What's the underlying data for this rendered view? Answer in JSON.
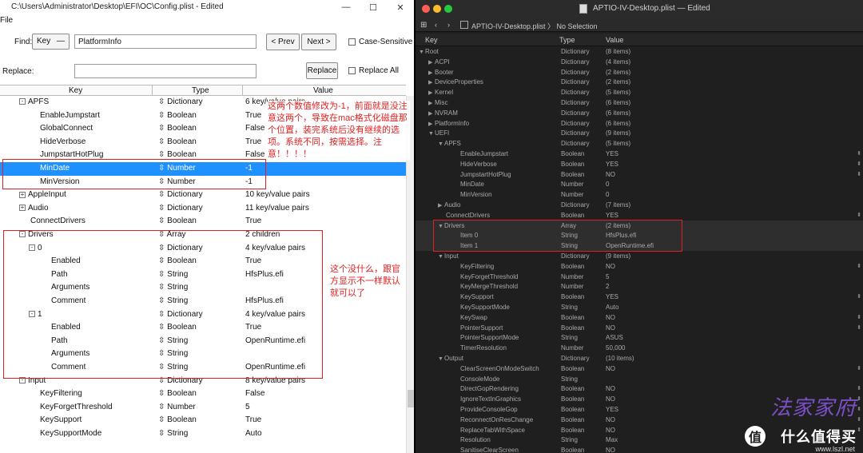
{
  "left": {
    "title": "C:\\Users\\Administrator\\Desktop\\EFI\\OC\\Config.plist - Edited",
    "win_minimize": "—",
    "win_maximize": "☐",
    "win_close": "✕",
    "menu_file": "File",
    "find_label": "Find:",
    "find_type": "Key",
    "find_value": "PlatformInfo",
    "prev_label": "< Prev",
    "next_label": "Next >",
    "case_label": "Case-Sensitive",
    "replace_label": "Replace:",
    "replace_value": "",
    "replace_btn": "Replace",
    "replace_all_label": "Replace All",
    "columns": {
      "key": "Key",
      "type": "Type",
      "value": "Value"
    },
    "rows": [
      {
        "k": "APFS",
        "t": "Dictionary",
        "v": "6 key/value pairs",
        "exp": "-",
        "indent": 1
      },
      {
        "k": "EnableJumpstart",
        "t": "Boolean",
        "v": "True",
        "exp": "",
        "indent": 2
      },
      {
        "k": "GlobalConnect",
        "t": "Boolean",
        "v": "False",
        "exp": "",
        "indent": 2
      },
      {
        "k": "HideVerbose",
        "t": "Boolean",
        "v": "True",
        "exp": "",
        "indent": 2
      },
      {
        "k": "JumpstartHotPlug",
        "t": "Boolean",
        "v": "False",
        "exp": "",
        "indent": 2
      },
      {
        "k": "MinDate",
        "t": "Number",
        "v": "-1",
        "exp": "",
        "indent": 2,
        "sel": true
      },
      {
        "k": "MinVersion",
        "t": "Number",
        "v": "-1",
        "exp": "",
        "indent": 2
      },
      {
        "k": "AppleInput",
        "t": "Dictionary",
        "v": "10 key/value pairs",
        "exp": "+",
        "indent": 1
      },
      {
        "k": "Audio",
        "t": "Dictionary",
        "v": "11 key/value pairs",
        "exp": "+",
        "indent": 1
      },
      {
        "k": "ConnectDrivers",
        "t": "Boolean",
        "v": "True",
        "exp": "",
        "indent": 1
      },
      {
        "k": "Drivers",
        "t": "Array",
        "v": "2 children",
        "exp": "-",
        "indent": 1
      },
      {
        "k": "0",
        "t": "Dictionary",
        "v": "4 key/value pairs",
        "exp": "-",
        "indent": 2
      },
      {
        "k": "Enabled",
        "t": "Boolean",
        "v": "True",
        "exp": "",
        "indent": 3
      },
      {
        "k": "Path",
        "t": "String",
        "v": "HfsPlus.efi",
        "exp": "",
        "indent": 3
      },
      {
        "k": "Arguments",
        "t": "String",
        "v": "",
        "exp": "",
        "indent": 3
      },
      {
        "k": "Comment",
        "t": "String",
        "v": "HfsPlus.efi",
        "exp": "",
        "indent": 3
      },
      {
        "k": "1",
        "t": "Dictionary",
        "v": "4 key/value pairs",
        "exp": "-",
        "indent": 2
      },
      {
        "k": "Enabled",
        "t": "Boolean",
        "v": "True",
        "exp": "",
        "indent": 3
      },
      {
        "k": "Path",
        "t": "String",
        "v": "OpenRuntime.efi",
        "exp": "",
        "indent": 3
      },
      {
        "k": "Arguments",
        "t": "String",
        "v": "",
        "exp": "",
        "indent": 3
      },
      {
        "k": "Comment",
        "t": "String",
        "v": "OpenRuntime.efi",
        "exp": "",
        "indent": 3
      },
      {
        "k": "Input",
        "t": "Dictionary",
        "v": "8 key/value pairs",
        "exp": "-",
        "indent": 1
      },
      {
        "k": "KeyFiltering",
        "t": "Boolean",
        "v": "False",
        "exp": "",
        "indent": 2
      },
      {
        "k": "KeyForgetThreshold",
        "t": "Number",
        "v": "5",
        "exp": "",
        "indent": 2
      },
      {
        "k": "KeySupport",
        "t": "Boolean",
        "v": "True",
        "exp": "",
        "indent": 2
      },
      {
        "k": "KeySupportMode",
        "t": "String",
        "v": "Auto",
        "exp": "",
        "indent": 2
      }
    ],
    "annotation1": "这两个数值修改为-1，前面就是没注意这两个，导致在mac格式化磁盘那个位置，装完系统后没有继续的选项。系统不同，按需选择。注意！！！！",
    "annotation2": "这个没什么，跟官方显示不一样默认就可以了"
  },
  "right": {
    "title": "APTIO-IV-Desktop.plist — Edited",
    "breadcrumb": "APTIO-IV-Desktop.plist 〉 No Selection",
    "columns": {
      "key": "Key",
      "type": "Type",
      "value": "Value"
    },
    "rows": [
      {
        "k": "Root",
        "t": "Dictionary",
        "v": "(8 items)",
        "tri": "▼",
        "indent": 0
      },
      {
        "k": "ACPI",
        "t": "Dictionary",
        "v": "(4 items)",
        "tri": "▶",
        "indent": 1
      },
      {
        "k": "Booter",
        "t": "Dictionary",
        "v": "(2 items)",
        "tri": "▶",
        "indent": 1
      },
      {
        "k": "DeviceProperties",
        "t": "Dictionary",
        "v": "(2 items)",
        "tri": "▶",
        "indent": 1
      },
      {
        "k": "Kernel",
        "t": "Dictionary",
        "v": "(5 items)",
        "tri": "▶",
        "indent": 1
      },
      {
        "k": "Misc",
        "t": "Dictionary",
        "v": "(6 items)",
        "tri": "▶",
        "indent": 1
      },
      {
        "k": "NVRAM",
        "t": "Dictionary",
        "v": "(6 items)",
        "tri": "▶",
        "indent": 1
      },
      {
        "k": "PlatformInfo",
        "t": "Dictionary",
        "v": "(6 items)",
        "tri": "▶",
        "indent": 1
      },
      {
        "k": "UEFI",
        "t": "Dictionary",
        "v": "(9 items)",
        "tri": "▼",
        "indent": 1
      },
      {
        "k": "APFS",
        "t": "Dictionary",
        "v": "(5 items)",
        "tri": "▼",
        "indent": 2
      },
      {
        "k": "EnableJumpstart",
        "t": "Boolean",
        "v": "YES",
        "tri": "",
        "indent": 3,
        "step": true
      },
      {
        "k": "HideVerbose",
        "t": "Boolean",
        "v": "YES",
        "tri": "",
        "indent": 3,
        "step": true
      },
      {
        "k": "JumpstartHotPlug",
        "t": "Boolean",
        "v": "NO",
        "tri": "",
        "indent": 3,
        "step": true
      },
      {
        "k": "MinDate",
        "t": "Number",
        "v": "0",
        "tri": "",
        "indent": 3
      },
      {
        "k": "MinVersion",
        "t": "Number",
        "v": "0",
        "tri": "",
        "indent": 3
      },
      {
        "k": "Audio",
        "t": "Dictionary",
        "v": "(7 items)",
        "tri": "▶",
        "indent": 2
      },
      {
        "k": "ConnectDrivers",
        "t": "Boolean",
        "v": "YES",
        "tri": "",
        "indent": 2,
        "step": true
      },
      {
        "k": "Drivers",
        "t": "Array",
        "v": "(2 items)",
        "tri": "▼",
        "indent": 2,
        "hl": true
      },
      {
        "k": "Item 0",
        "t": "String",
        "v": "HfsPlus.efi",
        "tri": "",
        "indent": 3,
        "hl": true
      },
      {
        "k": "Item 1",
        "t": "String",
        "v": "OpenRuntime.efi",
        "tri": "",
        "indent": 3,
        "hl": true
      },
      {
        "k": "Input",
        "t": "Dictionary",
        "v": "(9 items)",
        "tri": "▼",
        "indent": 2
      },
      {
        "k": "KeyFiltering",
        "t": "Boolean",
        "v": "NO",
        "tri": "",
        "indent": 3,
        "step": true
      },
      {
        "k": "KeyForgetThreshold",
        "t": "Number",
        "v": "5",
        "tri": "",
        "indent": 3
      },
      {
        "k": "KeyMergeThreshold",
        "t": "Number",
        "v": "2",
        "tri": "",
        "indent": 3
      },
      {
        "k": "KeySupport",
        "t": "Boolean",
        "v": "YES",
        "tri": "",
        "indent": 3,
        "step": true
      },
      {
        "k": "KeySupportMode",
        "t": "String",
        "v": "Auto",
        "tri": "",
        "indent": 3
      },
      {
        "k": "KeySwap",
        "t": "Boolean",
        "v": "NO",
        "tri": "",
        "indent": 3,
        "step": true
      },
      {
        "k": "PointerSupport",
        "t": "Boolean",
        "v": "NO",
        "tri": "",
        "indent": 3,
        "step": true
      },
      {
        "k": "PointerSupportMode",
        "t": "String",
        "v": "ASUS",
        "tri": "",
        "indent": 3
      },
      {
        "k": "TimerResolution",
        "t": "Number",
        "v": "50,000",
        "tri": "",
        "indent": 3
      },
      {
        "k": "Output",
        "t": "Dictionary",
        "v": "(10 items)",
        "tri": "▼",
        "indent": 2
      },
      {
        "k": "ClearScreenOnModeSwitch",
        "t": "Boolean",
        "v": "NO",
        "tri": "",
        "indent": 3,
        "step": true
      },
      {
        "k": "ConsoleMode",
        "t": "String",
        "v": "",
        "tri": "",
        "indent": 3
      },
      {
        "k": "DirectGopRendering",
        "t": "Boolean",
        "v": "NO",
        "tri": "",
        "indent": 3,
        "step": true
      },
      {
        "k": "IgnoreTextInGraphics",
        "t": "Boolean",
        "v": "NO",
        "tri": "",
        "indent": 3,
        "step": true
      },
      {
        "k": "ProvideConsoleGop",
        "t": "Boolean",
        "v": "YES",
        "tri": "",
        "indent": 3,
        "step": true
      },
      {
        "k": "ReconnectOnResChange",
        "t": "Boolean",
        "v": "NO",
        "tri": "",
        "indent": 3,
        "step": true
      },
      {
        "k": "ReplaceTabWithSpace",
        "t": "Boolean",
        "v": "NO",
        "tri": "",
        "indent": 3,
        "step": true
      },
      {
        "k": "Resolution",
        "t": "String",
        "v": "Max",
        "tri": "",
        "indent": 3
      },
      {
        "k": "SanitiseClearScreen",
        "t": "Boolean",
        "v": "NO",
        "tri": "",
        "indent": 3
      }
    ],
    "watermark_logo": "值",
    "watermark_text": "什么值得买",
    "watermark_site": "www.lszl.net",
    "watermark_brand": "法家家府"
  },
  "colors": {
    "selected": "#1e90ff",
    "annotation": "#e02020",
    "dark_bg": "#1f1f1f",
    "traffic_red": "#ff5f57",
    "traffic_yellow": "#febc2e",
    "traffic_green": "#28c840"
  }
}
